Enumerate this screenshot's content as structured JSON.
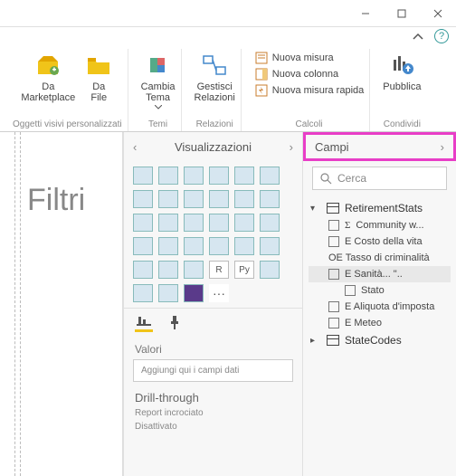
{
  "ribbon": {
    "marketplace": "Da\nMarketplace",
    "file": "Da\nFile",
    "group_visuals": "Oggetti visivi personalizzati",
    "theme": "Cambia\nTema",
    "group_themes": "Temi",
    "relations": "Gestisci\nRelazioni",
    "group_relations": "Relazioni",
    "new_measure": "Nuova misura",
    "new_column": "Nuova colonna",
    "quick_measure": "Nuova misura rapida",
    "group_calc": "Calcoli",
    "publish": "Pubblica",
    "group_share": "Condividi"
  },
  "canvas": {
    "watermark": "Filtri"
  },
  "viz": {
    "header": "Visualizzazioni",
    "values_label": "Valori",
    "well_placeholder": "Aggiungi qui i campi dati",
    "drill_header": "Drill-through",
    "drill_sub1": "Report incrociato",
    "drill_sub2": "Disattivato"
  },
  "fields": {
    "header": "Campi",
    "search_placeholder": "Cerca",
    "tables": [
      {
        "name": "RetirementStats",
        "expanded": true,
        "cols": [
          {
            "label": "Community w...",
            "sigma": true
          },
          {
            "label": "E Costo della vita"
          },
          {
            "label": "OE Tasso di criminalità",
            "nocb": true
          },
          {
            "label": "E Sanità... \"..",
            "selected": true
          },
          {
            "label": "Stato",
            "indent": true
          },
          {
            "label": "E Aliquota d'imposta"
          },
          {
            "label": "E Meteo"
          }
        ]
      },
      {
        "name": "StateCodes",
        "expanded": false
      }
    ]
  }
}
